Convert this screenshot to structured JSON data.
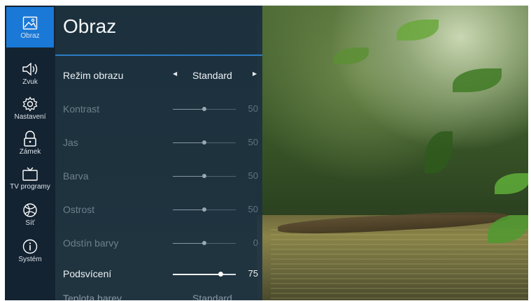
{
  "sidebar": {
    "items": [
      {
        "label": "Obraz",
        "icon": "picture-icon",
        "active": true
      },
      {
        "label": "Zvuk",
        "icon": "speaker-icon",
        "active": false
      },
      {
        "label": "Nastavení",
        "icon": "gear-icon",
        "active": false
      },
      {
        "label": "Zámek",
        "icon": "lock-icon",
        "active": false
      },
      {
        "label": "TV programy",
        "icon": "tv-icon",
        "active": false
      },
      {
        "label": "Síť",
        "icon": "globe-icon",
        "active": false
      },
      {
        "label": "Systém",
        "icon": "info-icon",
        "active": false
      }
    ]
  },
  "panel": {
    "title": "Obraz",
    "mode": {
      "label": "Režim obrazu",
      "value": "Standard"
    },
    "sliders": [
      {
        "label": "Kontrast",
        "value": "50",
        "level": 50,
        "enabled": false
      },
      {
        "label": "Jas",
        "value": "50",
        "level": 50,
        "enabled": false
      },
      {
        "label": "Barva",
        "value": "50",
        "level": 50,
        "enabled": false
      },
      {
        "label": "Ostrost",
        "value": "50",
        "level": 50,
        "enabled": false
      },
      {
        "label": "Odstín barvy",
        "value": "0",
        "level": 50,
        "enabled": false
      },
      {
        "label": "Podsvícení",
        "value": "75",
        "level": 75,
        "enabled": true
      }
    ],
    "partial_row": {
      "label": "Teplota barev",
      "value": "Standard"
    }
  },
  "colors": {
    "accent": "#1a78d6",
    "sidebar_bg": "#142331",
    "panel_bg": "#1e3242"
  }
}
